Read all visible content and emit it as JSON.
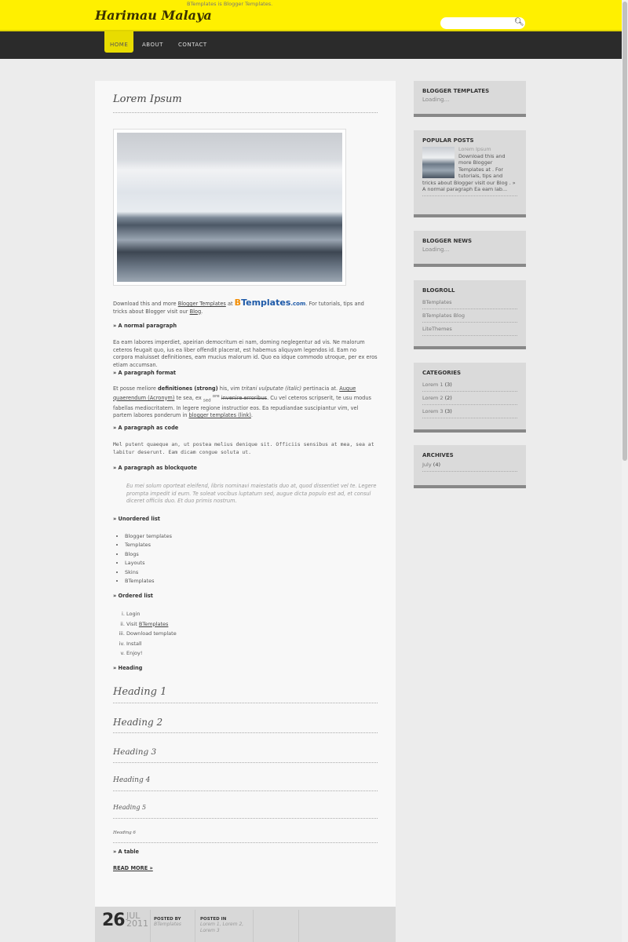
{
  "header": {
    "title": "Harimau Malaya",
    "description": "BTemplates is Blogger Templates.",
    "search_placeholder": ""
  },
  "nav": [
    {
      "label": "HOME"
    },
    {
      "label": "ABOUT"
    },
    {
      "label": "CONTACT"
    }
  ],
  "post": {
    "title": "Lorem Ipsum",
    "intro": {
      "t1": "Download this and more ",
      "l1": "Blogger Templates",
      "t2": " at ",
      "logo_b": "B",
      "logo_rest": "Templates",
      "logo_com": ".com",
      "t3": ". For tutorials, tips and tricks about Blogger visit our ",
      "l2": "Blog",
      "t4": "."
    },
    "s1": "» A normal paragraph",
    "p1": "Ea eam labores imperdiet, apeirian democritum ei nam, doming neglegentur ad vis. Ne malorum ceteros feugait quo, ius ea liber offendit placerat, est habemus aliquyam legendos id. Eam no corpora maluisset definitiones, eam mucius malorum id. Quo ea idque commodo utroque, per ex eros etiam accumsan.",
    "s2": "» A paragraph format",
    "p2": {
      "a": "Et posse meliore ",
      "strong": "definitiones (strong)",
      "b": " his, vim ",
      "em": "tritani vulputate (italic)",
      "c": " pertinacia at. ",
      "acr": "Augue quaerendum (Acronym)",
      "d": " te sea, ex ",
      "sub": "sed",
      "sup": "ore",
      "del": "invenire erroribus",
      "e": ". Cu vel ceteros scripserit, te usu modus fabellas mediocritatem. In legere regione instructior eos. Ea repudiandae suscipiantur vim, vel partem labores ponderum in ",
      "link": "blogger templates (link)",
      "f": "."
    },
    "s3": "» A paragraph as code",
    "code": "Mel putent quaeque an, ut postea melius denique sit. Officiis sensibus at mea, sea at labitur deserunt. Eam dicam congue soluta ut.",
    "s4": "» A paragraph as blockquote",
    "quote": "Eu mei solum oporteat eleifend, libris nominavi maiestatis duo at, quod dissentiet vel te. Legere prompta impedit id eum. Te soleat vocibus luptatum sed, augue dicta populo est ad, et consul diceret officiis duo. Et duo primis nostrum.",
    "s5": "» Unordered list",
    "ul": [
      "Blogger templates",
      "Templates",
      "Blogs",
      "Layouts",
      "Skins",
      "BTemplates"
    ],
    "s6": "» Ordered list",
    "ol": {
      "i1": "Login",
      "i2a": "Visit ",
      "i2b": "BTemplates",
      "i3": "Download template",
      "i4": "Install",
      "i5": "Enjoy!"
    },
    "s7": "» Heading",
    "headings": [
      "Heading 1",
      "Heading 2",
      "Heading 3",
      "Heading 4",
      "Heading 5",
      "Heading 6"
    ],
    "s8": "» A table",
    "read_more": "READ MORE »",
    "footer": {
      "day": "26",
      "month": "JUL",
      "year": "2011",
      "posted_by_label": "POSTED BY",
      "author": "BTemplates",
      "posted_in_label": "POSTED IN",
      "labels": "Lorem 1, Lorem 2, Lorem 3"
    }
  },
  "sidebar": {
    "blogger_templates": {
      "title": "BLOGGER TEMPLATES",
      "text": "Loading..."
    },
    "popular": {
      "title": "POPULAR POSTS",
      "post_title": "Lorem Ipsum",
      "snippet": "Download this and more Blogger Templates at . For tutorials, tips and tricks about Blogger visit our Blog . » A normal paragraph Ea eam lab..."
    },
    "news": {
      "title": "BLOGGER NEWS",
      "text": "Loading..."
    },
    "blogroll": {
      "title": "BLOGROLL",
      "items": [
        "BTemplates",
        "BTemplates Blog",
        "LiteThemes"
      ]
    },
    "categories": {
      "title": "CATEGORIES",
      "items": [
        {
          "name": "Lorem 1",
          "count": "(3)"
        },
        {
          "name": "Lorem 2",
          "count": "(2)"
        },
        {
          "name": "Lorem 3",
          "count": "(3)"
        }
      ]
    },
    "archives": {
      "title": "ARCHIVES",
      "items": [
        {
          "name": "July",
          "count": "(4)"
        }
      ]
    }
  }
}
